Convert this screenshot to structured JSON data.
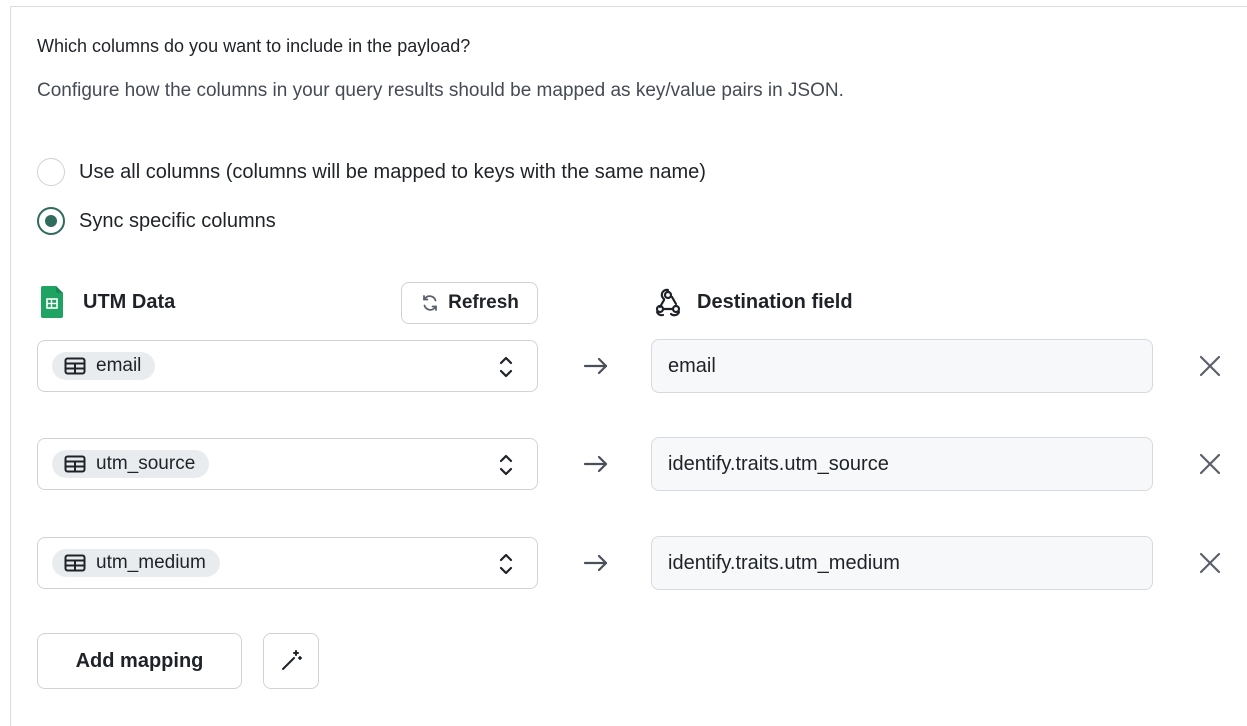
{
  "section": {
    "title": "Which columns do you want to include in the payload?",
    "description": "Configure how the columns in your query results should be mapped as key/value pairs in JSON."
  },
  "options": [
    {
      "label": "Use all columns (columns will be mapped to keys with the same name)",
      "selected": false
    },
    {
      "label": "Sync specific columns",
      "selected": true
    }
  ],
  "source": {
    "title": "UTM Data",
    "icon": "google-sheets-icon",
    "refresh_label": "Refresh"
  },
  "destination": {
    "title": "Destination field",
    "icon": "webhook-icon"
  },
  "mappings": [
    {
      "column": "email",
      "field": "email"
    },
    {
      "column": "utm_source",
      "field": "identify.traits.utm_source"
    },
    {
      "column": "utm_medium",
      "field": "identify.traits.utm_medium"
    }
  ],
  "actions": {
    "add_mapping_label": "Add mapping",
    "magic_icon": "magic-wand-icon"
  },
  "colors": {
    "accent": "#2f6b5e",
    "sheets_green": "#1ea362"
  }
}
